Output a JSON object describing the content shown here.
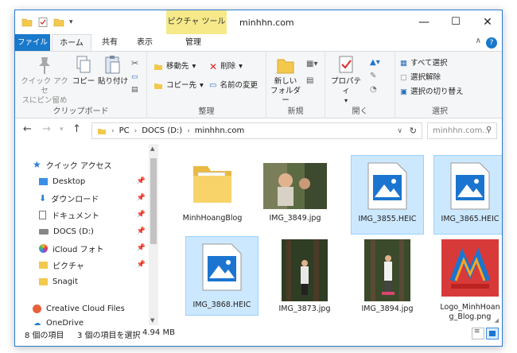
{
  "window": {
    "title": "minhhn.com",
    "context_tab_header": "ピクチャ ツール",
    "controls": {
      "minimize": "—",
      "maximize": "☐",
      "close": "✕"
    }
  },
  "tabs": [
    {
      "label": "ファイル"
    },
    {
      "label": "ホーム"
    },
    {
      "label": "共有"
    },
    {
      "label": "表示"
    },
    {
      "label": "管理"
    }
  ],
  "ribbon": {
    "clipboard": {
      "label": "クリップボード",
      "pin_label": "クイック アクセ\nスにピン留め",
      "copy_label": "コピー",
      "paste_label": "貼り付け"
    },
    "organize": {
      "label": "整理",
      "move_label": "移動先",
      "copy_to_label": "コピー先",
      "delete_label": "削除",
      "rename_label": "名前の変更"
    },
    "new": {
      "label": "新規",
      "new_folder_label": "新しい\nフォルダー"
    },
    "open": {
      "label": "開く",
      "properties_label": "プロパティ"
    },
    "select": {
      "label": "選択",
      "select_all": "すべて選択",
      "select_none": "選択解除",
      "invert": "選択の切り替え"
    }
  },
  "address": {
    "segments": [
      "PC",
      "DOCS (D:)",
      "minhhn.com"
    ],
    "search_placeholder": "minhhn.com..."
  },
  "nav": {
    "quick_access": "クイック アクセス",
    "items": [
      {
        "label": "Desktop",
        "pinned": true
      },
      {
        "label": "ダウンロード",
        "pinned": true
      },
      {
        "label": "ドキュメント",
        "pinned": true
      },
      {
        "label": "DOCS (D:)",
        "pinned": true
      },
      {
        "label": "iCloud フォト",
        "pinned": true
      },
      {
        "label": "ピクチャ",
        "pinned": true
      },
      {
        "label": "Snagit",
        "pinned": false
      }
    ],
    "creative_cloud": "Creative Cloud Files",
    "onedrive": "OneDrive"
  },
  "files": [
    {
      "name": "MinhHoangBlog",
      "type": "folder",
      "selected": false
    },
    {
      "name": "IMG_3849.jpg",
      "type": "photo",
      "selected": false
    },
    {
      "name": "IMG_3855.HEIC",
      "type": "heic",
      "selected": true
    },
    {
      "name": "IMG_3865.HEIC",
      "type": "heic",
      "selected": true
    },
    {
      "name": "IMG_3868.HEIC",
      "type": "heic",
      "selected": true
    },
    {
      "name": "IMG_3873.jpg",
      "type": "photo",
      "selected": false
    },
    {
      "name": "IMG_3894.jpg",
      "type": "photo",
      "selected": false
    },
    {
      "name": "Logo_MinhHoan\ng_Blog.png",
      "type": "logo",
      "selected": false
    }
  ],
  "status": {
    "item_count": "8 個の項目",
    "selection": "3 個の項目を選択",
    "size": "4.94 MB"
  },
  "colors": {
    "accent": "#1979ca",
    "selection_bg": "#cce8ff",
    "selection_border": "#99d1ff",
    "context_tab": "#f6e98a",
    "heic_icon": "#1b75d0",
    "logo_bg": "#d83a3a"
  }
}
